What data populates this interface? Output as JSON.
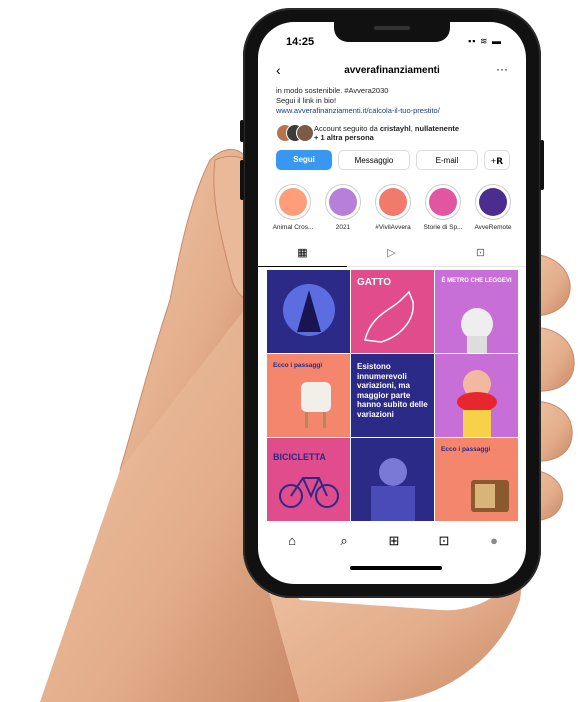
{
  "status_bar": {
    "time": "14:25",
    "icons": "▪▪ ≋ ▬"
  },
  "profile": {
    "back_label": "‹",
    "username": "avverafinanziamenti",
    "more_label": "···",
    "bio_line1": "in modo sostenibile. #Avvera2030",
    "bio_line2": "Segui il link in bio!",
    "bio_link": "www.avverafinanziamenti.it/calcola-il-tuo-prestito/",
    "followed_prefix": "Account seguito da ",
    "followed_name": "cristayhl",
    "followed_sep": ", ",
    "followed_name2": "nullatenente",
    "followed_suffix": "+ 1 altra persona"
  },
  "buttons": {
    "follow": "Segui",
    "message": "Messaggio",
    "email": "E-mail",
    "add_person": "+𝗥"
  },
  "highlights": [
    {
      "label": "Animal Cros...",
      "color": "#ff9d7a"
    },
    {
      "label": "2021",
      "color": "#b77fd9"
    },
    {
      "label": "#VivilAvvera",
      "color": "#f07a6b"
    },
    {
      "label": "Storie di Sp...",
      "color": "#e056a0"
    },
    {
      "label": "AvveRemote",
      "color": "#4a2d8f"
    }
  ],
  "tabs": [
    "▦",
    "▷",
    "⊡"
  ],
  "grid": [
    {
      "text": "",
      "bg": "#2b2a86"
    },
    {
      "text": "GATTO",
      "bg": "#e04c8c"
    },
    {
      "text": "È METRO CHE LEGGEVI",
      "bg": "#c76fd6"
    },
    {
      "text": "Ecco i passaggi",
      "bg": "#f4866e"
    },
    {
      "text": "Esistono innumerevoli variazioni, ma maggior parte hanno subito delle variazioni",
      "bg": "#2b2a86"
    },
    {
      "text": "",
      "bg": "#c76fd6"
    },
    {
      "text": "BICICLETTA",
      "bg": "#e04c8c"
    },
    {
      "text": "",
      "bg": "#2b2a86"
    },
    {
      "text": "Ecco i passaggi",
      "bg": "#f4866e"
    }
  ],
  "nav": [
    "⌂",
    "⌕",
    "⊞",
    "⊡",
    "●"
  ],
  "colors": {
    "accent": "#3897f0",
    "skin": "#e8b596",
    "phone": "#111111"
  }
}
